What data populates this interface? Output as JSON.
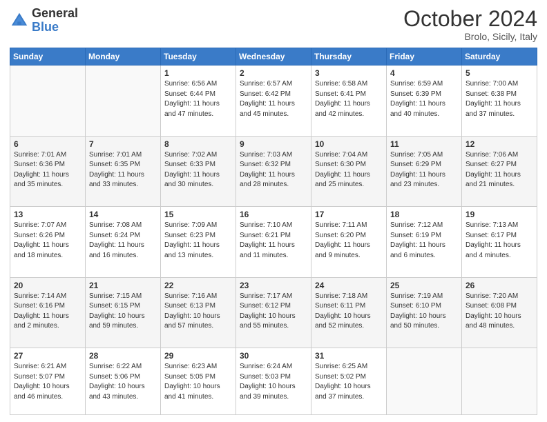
{
  "header": {
    "logo_general": "General",
    "logo_blue": "Blue",
    "month": "October 2024",
    "location": "Brolo, Sicily, Italy"
  },
  "weekdays": [
    "Sunday",
    "Monday",
    "Tuesday",
    "Wednesday",
    "Thursday",
    "Friday",
    "Saturday"
  ],
  "weeks": [
    [
      {
        "day": "",
        "content": ""
      },
      {
        "day": "",
        "content": ""
      },
      {
        "day": "1",
        "content": "Sunrise: 6:56 AM\nSunset: 6:44 PM\nDaylight: 11 hours and 47 minutes."
      },
      {
        "day": "2",
        "content": "Sunrise: 6:57 AM\nSunset: 6:42 PM\nDaylight: 11 hours and 45 minutes."
      },
      {
        "day": "3",
        "content": "Sunrise: 6:58 AM\nSunset: 6:41 PM\nDaylight: 11 hours and 42 minutes."
      },
      {
        "day": "4",
        "content": "Sunrise: 6:59 AM\nSunset: 6:39 PM\nDaylight: 11 hours and 40 minutes."
      },
      {
        "day": "5",
        "content": "Sunrise: 7:00 AM\nSunset: 6:38 PM\nDaylight: 11 hours and 37 minutes."
      }
    ],
    [
      {
        "day": "6",
        "content": "Sunrise: 7:01 AM\nSunset: 6:36 PM\nDaylight: 11 hours and 35 minutes."
      },
      {
        "day": "7",
        "content": "Sunrise: 7:01 AM\nSunset: 6:35 PM\nDaylight: 11 hours and 33 minutes."
      },
      {
        "day": "8",
        "content": "Sunrise: 7:02 AM\nSunset: 6:33 PM\nDaylight: 11 hours and 30 minutes."
      },
      {
        "day": "9",
        "content": "Sunrise: 7:03 AM\nSunset: 6:32 PM\nDaylight: 11 hours and 28 minutes."
      },
      {
        "day": "10",
        "content": "Sunrise: 7:04 AM\nSunset: 6:30 PM\nDaylight: 11 hours and 25 minutes."
      },
      {
        "day": "11",
        "content": "Sunrise: 7:05 AM\nSunset: 6:29 PM\nDaylight: 11 hours and 23 minutes."
      },
      {
        "day": "12",
        "content": "Sunrise: 7:06 AM\nSunset: 6:27 PM\nDaylight: 11 hours and 21 minutes."
      }
    ],
    [
      {
        "day": "13",
        "content": "Sunrise: 7:07 AM\nSunset: 6:26 PM\nDaylight: 11 hours and 18 minutes."
      },
      {
        "day": "14",
        "content": "Sunrise: 7:08 AM\nSunset: 6:24 PM\nDaylight: 11 hours and 16 minutes."
      },
      {
        "day": "15",
        "content": "Sunrise: 7:09 AM\nSunset: 6:23 PM\nDaylight: 11 hours and 13 minutes."
      },
      {
        "day": "16",
        "content": "Sunrise: 7:10 AM\nSunset: 6:21 PM\nDaylight: 11 hours and 11 minutes."
      },
      {
        "day": "17",
        "content": "Sunrise: 7:11 AM\nSunset: 6:20 PM\nDaylight: 11 hours and 9 minutes."
      },
      {
        "day": "18",
        "content": "Sunrise: 7:12 AM\nSunset: 6:19 PM\nDaylight: 11 hours and 6 minutes."
      },
      {
        "day": "19",
        "content": "Sunrise: 7:13 AM\nSunset: 6:17 PM\nDaylight: 11 hours and 4 minutes."
      }
    ],
    [
      {
        "day": "20",
        "content": "Sunrise: 7:14 AM\nSunset: 6:16 PM\nDaylight: 11 hours and 2 minutes."
      },
      {
        "day": "21",
        "content": "Sunrise: 7:15 AM\nSunset: 6:15 PM\nDaylight: 10 hours and 59 minutes."
      },
      {
        "day": "22",
        "content": "Sunrise: 7:16 AM\nSunset: 6:13 PM\nDaylight: 10 hours and 57 minutes."
      },
      {
        "day": "23",
        "content": "Sunrise: 7:17 AM\nSunset: 6:12 PM\nDaylight: 10 hours and 55 minutes."
      },
      {
        "day": "24",
        "content": "Sunrise: 7:18 AM\nSunset: 6:11 PM\nDaylight: 10 hours and 52 minutes."
      },
      {
        "day": "25",
        "content": "Sunrise: 7:19 AM\nSunset: 6:10 PM\nDaylight: 10 hours and 50 minutes."
      },
      {
        "day": "26",
        "content": "Sunrise: 7:20 AM\nSunset: 6:08 PM\nDaylight: 10 hours and 48 minutes."
      }
    ],
    [
      {
        "day": "27",
        "content": "Sunrise: 6:21 AM\nSunset: 5:07 PM\nDaylight: 10 hours and 46 minutes."
      },
      {
        "day": "28",
        "content": "Sunrise: 6:22 AM\nSunset: 5:06 PM\nDaylight: 10 hours and 43 minutes."
      },
      {
        "day": "29",
        "content": "Sunrise: 6:23 AM\nSunset: 5:05 PM\nDaylight: 10 hours and 41 minutes."
      },
      {
        "day": "30",
        "content": "Sunrise: 6:24 AM\nSunset: 5:03 PM\nDaylight: 10 hours and 39 minutes."
      },
      {
        "day": "31",
        "content": "Sunrise: 6:25 AM\nSunset: 5:02 PM\nDaylight: 10 hours and 37 minutes."
      },
      {
        "day": "",
        "content": ""
      },
      {
        "day": "",
        "content": ""
      }
    ]
  ]
}
